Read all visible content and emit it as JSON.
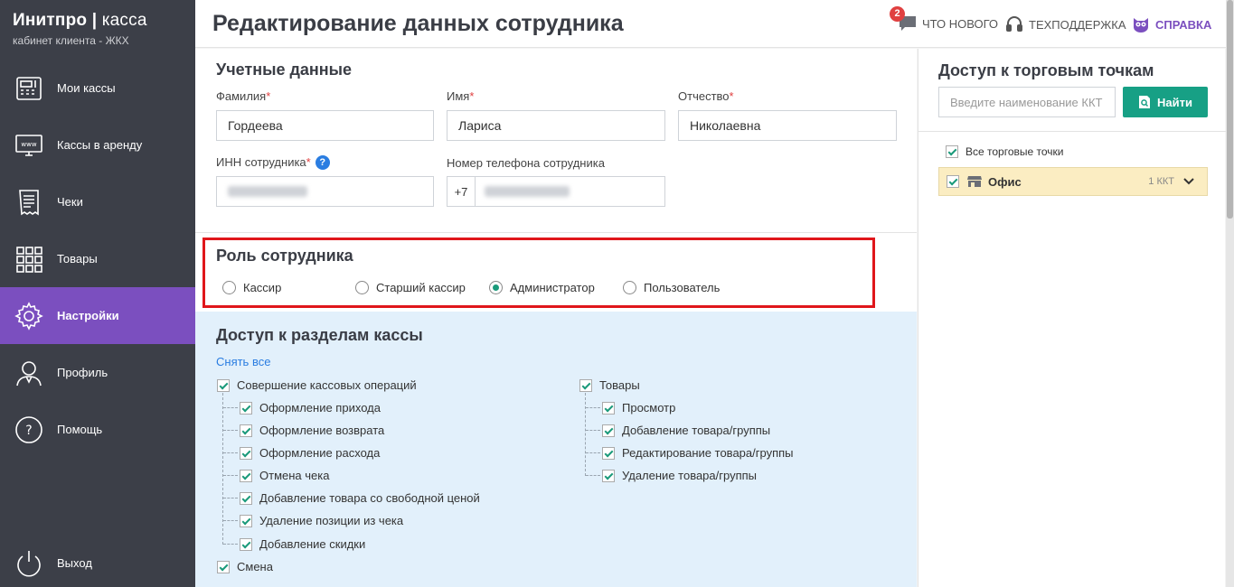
{
  "brand": {
    "title_main": "Инитпро",
    "title_sep": "|",
    "title_thin": "касса",
    "subtitle": "кабинет клиента - ЖКХ"
  },
  "nav": {
    "items": [
      {
        "label": "Мои кассы",
        "icon": "cash-register-icon"
      },
      {
        "label": "Кассы в аренду",
        "icon": "www-monitor-icon"
      },
      {
        "label": "Чеки",
        "icon": "receipt-icon"
      },
      {
        "label": "Товары",
        "icon": "grid-icon"
      },
      {
        "label": "Настройки",
        "icon": "gear-icon",
        "active": true
      },
      {
        "label": "Профиль",
        "icon": "user-icon"
      },
      {
        "label": "Помощь",
        "icon": "question-icon"
      }
    ],
    "logout": "Выход"
  },
  "header": {
    "title": "Редактирование данных сотрудника",
    "whats_new": "ЧТО НОВОГО",
    "whats_new_badge": "2",
    "support": "ТЕХПОДДЕРЖКА",
    "help": "СПРАВКА"
  },
  "credentials": {
    "title": "Учетные данные",
    "last_name_label": "Фамилия",
    "first_name_label": "Имя",
    "patronymic_label": "Отчество",
    "required_mark": "*",
    "last_name": "Гордеева",
    "first_name": "Лариса",
    "patronymic": "Николаевна",
    "inn_label": "ИНН сотрудника",
    "inn_help": "?",
    "phone_label": "Номер телефона сотрудника",
    "phone_prefix": "+7"
  },
  "role": {
    "title": "Роль сотрудника",
    "options": [
      "Кассир",
      "Старший кассир",
      "Администратор",
      "Пользователь"
    ],
    "selected": "Администратор"
  },
  "access": {
    "title": "Доступ к разделам кассы",
    "deselect_all": "Снять все",
    "group1": {
      "label": "Совершение кассовых операций",
      "items": [
        "Оформление прихода",
        "Оформление возврата",
        "Оформление расхода",
        "Отмена чека",
        "Добавление товара со свободной ценой",
        "Удаление позиции из чека",
        "Добавление скидки"
      ]
    },
    "group2": {
      "label": "Товары",
      "items": [
        "Просмотр",
        "Добавление товара/группы",
        "Редактирование товара/группы",
        "Удаление товара/группы"
      ]
    },
    "group3": {
      "label": "Смена"
    }
  },
  "stores": {
    "title": "Доступ к торговым точкам",
    "search_placeholder": "Введите наименование ККТ",
    "find_button": "Найти",
    "all_label": "Все торговые точки",
    "office_label": "Офис",
    "office_count": "1 ККТ"
  },
  "colors": {
    "accent": "#7b4fbf",
    "sidebar": "#3c3f48",
    "teal": "#17a085",
    "highlight": "#e0161b"
  }
}
